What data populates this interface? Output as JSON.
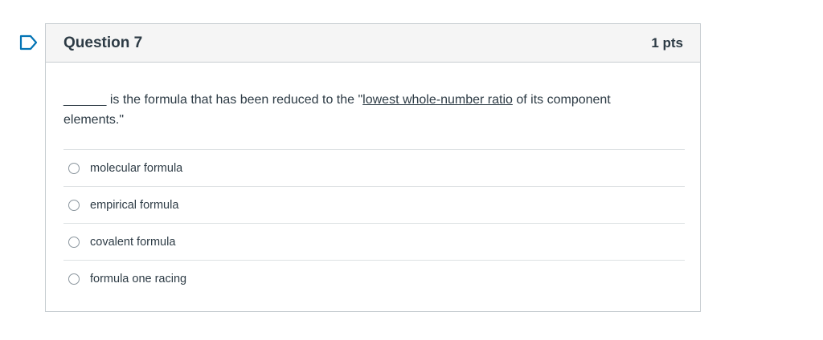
{
  "question": {
    "title": "Question 7",
    "points": "1 pts",
    "text_blank": "______",
    "text_before": " is the formula that has been reduced to the \"",
    "text_link": "lowest whole-number ratio",
    "text_after": " of its component elements.\""
  },
  "answers": [
    {
      "label": "molecular formula",
      "selected": false
    },
    {
      "label": "empirical formula",
      "selected": false
    },
    {
      "label": "covalent formula",
      "selected": false
    },
    {
      "label": "formula one racing",
      "selected": false
    }
  ],
  "colors": {
    "flag": "#0374b5",
    "text": "#2d3b45",
    "header_bg": "#f5f5f5",
    "border": "#c7cdd1"
  },
  "icons": {
    "flag": "flag-icon",
    "radio": "radio-icon"
  }
}
